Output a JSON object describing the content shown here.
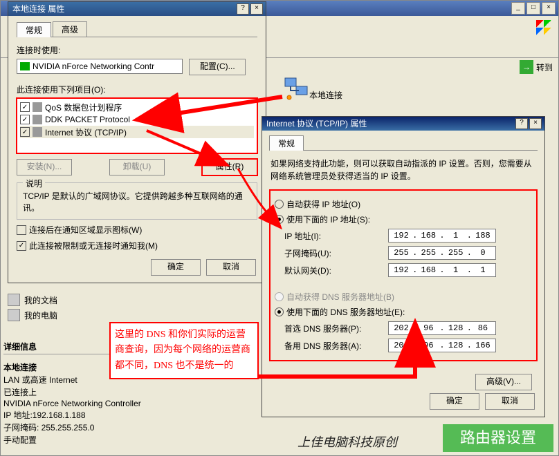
{
  "background": {
    "go_label": "转到",
    "connection_label": "本地连接",
    "sidebar": {
      "items": [
        {
          "label": "我的文档"
        },
        {
          "label": "我的电脑"
        }
      ]
    },
    "details": {
      "heading": "详细信息",
      "conn_name": "本地连接",
      "lines": [
        "LAN 或高速 Internet",
        "已连接上",
        "NVIDIA nForce Networking Controller",
        "IP 地址:192.168.1.188",
        "子网掩码: 255.255.255.0",
        "手动配置"
      ]
    }
  },
  "dlg1": {
    "title": "本地连接 属性",
    "tabs": [
      "常规",
      "高级"
    ],
    "connect_using_label": "连接时使用:",
    "adapter": "NVIDIA nForce Networking Contr",
    "configure_btn": "配置(C)...",
    "uses_items_label": "此连接使用下列项目(O):",
    "items": [
      {
        "checked": true,
        "label": "QoS 数据包计划程序"
      },
      {
        "checked": true,
        "label": "DDK PACKET Protocol"
      },
      {
        "checked": true,
        "label": "Internet 协议 (TCP/IP)"
      }
    ],
    "buttons": {
      "install": "安装(N)...",
      "uninstall": "卸载(U)",
      "properties": "属性(R)"
    },
    "desc_legend": "说明",
    "description": "TCP/IP 是默认的广域网协议。它提供跨越多种互联网络的通讯。",
    "checks": [
      {
        "checked": false,
        "label": "连接后在通知区域显示图标(W)"
      },
      {
        "checked": true,
        "label": "此连接被限制或无连接时通知我(M)"
      }
    ],
    "footer": {
      "ok": "确定",
      "cancel": "取消"
    }
  },
  "dlg2": {
    "title": "Internet 协议 (TCP/IP) 属性",
    "tab": "常规",
    "info": "如果网络支持此功能，则可以获取自动指派的 IP 设置。否则，您需要从网络系统管理员处获得适当的 IP 设置。",
    "radios": {
      "auto_ip": "自动获得 IP 地址(O)",
      "use_ip": "使用下面的 IP 地址(S):",
      "auto_dns": "自动获得 DNS 服务器地址(B)",
      "use_dns": "使用下面的 DNS 服务器地址(E):"
    },
    "fields": {
      "ip_label": "IP 地址(I):",
      "ip_value": [
        "192",
        "168",
        "1",
        "188"
      ],
      "mask_label": "子网掩码(U):",
      "mask_value": [
        "255",
        "255",
        "255",
        "0"
      ],
      "gw_label": "默认网关(D):",
      "gw_value": [
        "192",
        "168",
        "1",
        "1"
      ],
      "dns1_label": "首选 DNS 服务器(P):",
      "dns1_value": [
        "202",
        "96",
        "128",
        "86"
      ],
      "dns2_label": "备用 DNS 服务器(A):",
      "dns2_value": [
        "202",
        "96",
        "128",
        "166"
      ]
    },
    "advanced_btn": "高级(V)...",
    "footer": {
      "ok": "确定",
      "cancel": "取消"
    }
  },
  "callout": "这里的 DNS 和你们实际的运营商查询，因为每个网络的运营商都不同，DNS 也不是统一的",
  "footer_text": "上佳电脑科技原创",
  "footer_badge": "路由器设置"
}
